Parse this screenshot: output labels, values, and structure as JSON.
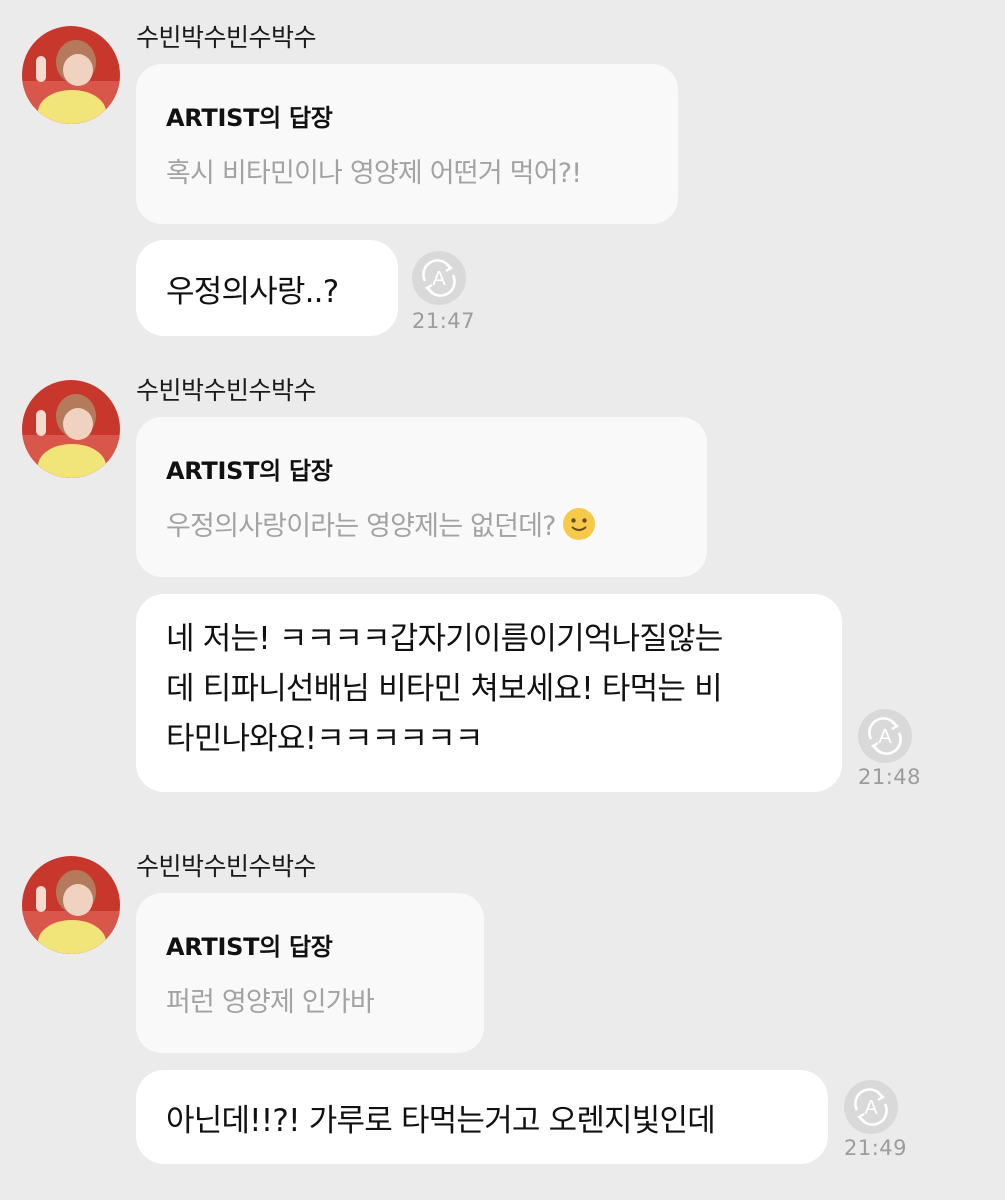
{
  "conversation": [
    {
      "sender": "수빈박수빈수박수",
      "reply_header": "ARTIST의 답장",
      "reply_text": "혹시 비타민이나 영양제 어떤거 먹어?!",
      "message_lines": [
        "우정의사랑..?"
      ],
      "time": "21:47"
    },
    {
      "sender": "수빈박수빈수박수",
      "reply_header": "ARTIST의 답장",
      "reply_text": "우정의사랑이라는 영양제는 없던데?",
      "reply_emoji": "slightly-smiling-face",
      "message_lines": [
        "네 저는! ㅋㅋㅋㅋ갑자기이름이기억나질않는",
        "데 티파니선배님 비타민 쳐보세요! 타먹는 비",
        "타민나와요!ㅋㅋㅋㅋㅋㅋ"
      ],
      "time": "21:48"
    },
    {
      "sender": "수빈박수빈수박수",
      "reply_header": "ARTIST의 답장",
      "reply_text": "퍼런 영양제 인가바",
      "message_lines": [
        "아닌데!!?! 가루로 타먹는거고 오렌지빛인데"
      ],
      "time": "21:49"
    }
  ],
  "icons": {
    "avatar": "profile-photo",
    "translate": "auto-translate-icon"
  },
  "colors": {
    "background": "#ebebeb",
    "message_bubble": "#ffffff",
    "reply_bubble": "#f9f9f9",
    "reply_text": "#a3a3a3",
    "timestamp": "#9c9c9c"
  }
}
